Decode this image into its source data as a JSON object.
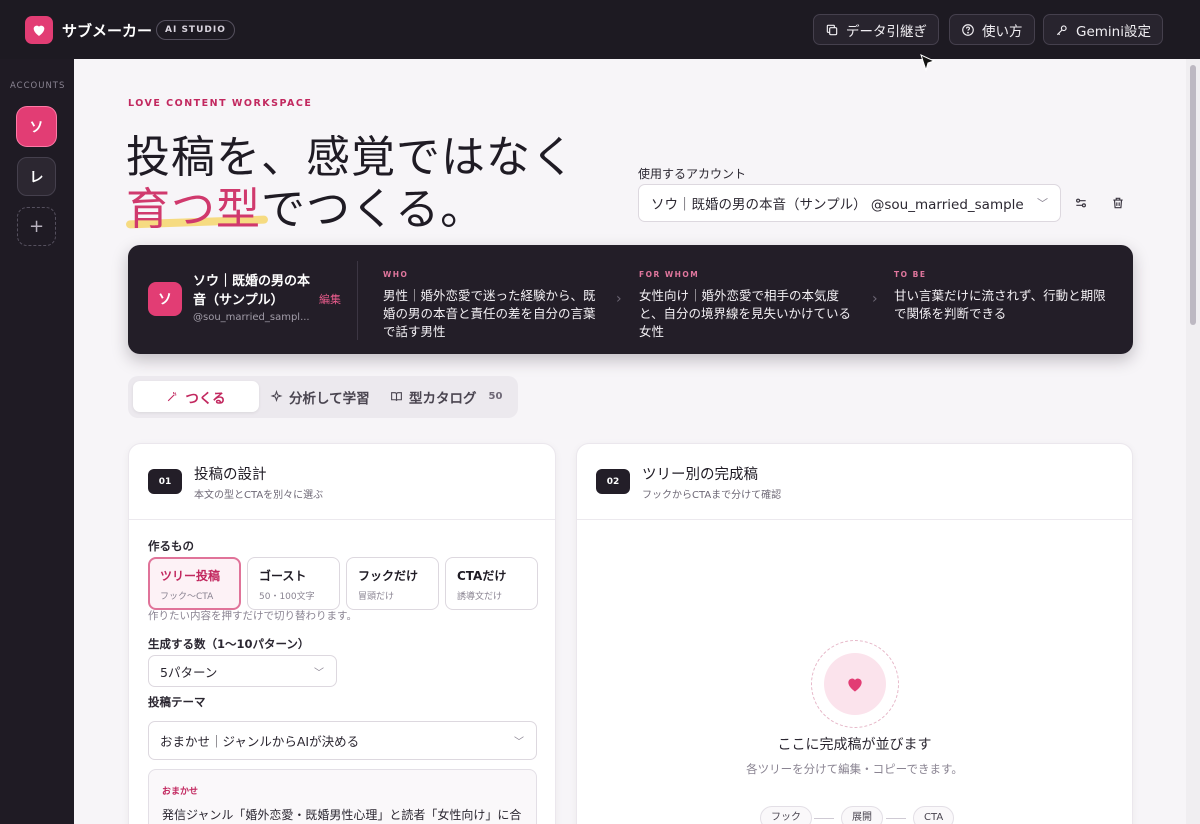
{
  "app": {
    "name": "サブメーカー",
    "badge": "AI STUDIO"
  },
  "topbar": {
    "data_transfer": "データ引継ぎ",
    "how_to": "使い方",
    "gemini_settings": "Gemini設定"
  },
  "sidebar": {
    "label": "ACCOUNTS",
    "accounts": [
      {
        "initial": "ソ",
        "active": true
      },
      {
        "initial": "レ",
        "active": false
      }
    ],
    "add": "+"
  },
  "hero": {
    "eyebrow": "LOVE CONTENT WORKSPACE",
    "line1": "投稿を、感覚ではなく",
    "line2_accent": "育つ型",
    "line2_rest": "でつくる。"
  },
  "account_picker": {
    "label": "使用するアカウント",
    "value": "ソウ｜既婚の男の本音（サンプル） @sou_married_sample"
  },
  "profile": {
    "initial": "ソ",
    "name": "ソウ｜既婚の男の本音（サンプル）",
    "handle": "@sou_married_sampl...",
    "edit": "編集",
    "who_tag": "WHO",
    "who_text": "男性｜婚外恋愛で迷った経験から、既婚の男の本音と責任の差を自分の言葉で話す男性",
    "for_whom_tag": "FOR WHOM",
    "for_whom_text": "女性向け｜婚外恋愛で相手の本気度と、自分の境界線を見失いかけている女性",
    "to_be_tag": "TO BE",
    "to_be_text": "甘い言葉だけに流されず、行動と期限で関係を判断できる"
  },
  "tabs": {
    "create": "つくる",
    "analyze": "分析して学習",
    "catalog": "型カタログ",
    "catalog_count": "50"
  },
  "design_card": {
    "step": "01",
    "title": "投稿の設計",
    "subtitle": "本文の型とCTAを別々に選ぶ",
    "what_label": "作るもの",
    "options": [
      {
        "title": "ツリー投稿",
        "sub": "フック〜CTA",
        "selected": true
      },
      {
        "title": "ゴースト",
        "sub": "50・100文字",
        "selected": false
      },
      {
        "title": "フックだけ",
        "sub": "冒頭だけ",
        "selected": false
      },
      {
        "title": "CTAだけ",
        "sub": "誘導文だけ",
        "selected": false
      }
    ],
    "hint": "作りたい内容を押すだけで切り替わります。",
    "count_label": "生成する数（1〜10パターン）",
    "count_value": "5パターン",
    "theme_label": "投稿テーマ",
    "theme_value": "おまかせ｜ジャンルからAIが決める",
    "info_tag": "おまかせ",
    "info_text": "発信ジャンル「婚外恋愛・既婚男性心理」と読者「女性向け」に合"
  },
  "result_card": {
    "step": "02",
    "title": "ツリー別の完成稿",
    "subtitle": "フックからCTAまで分けて確認",
    "empty_title": "ここに完成稿が並びます",
    "empty_sub": "各ツリーを分けて編集・コピーできます。",
    "flow": [
      "フック",
      "展開",
      "CTA"
    ]
  },
  "colors": {
    "brand": "#e23d74",
    "accent_text": "#c2285f",
    "dark": "#231e28",
    "highlight": "#f6d66c"
  }
}
